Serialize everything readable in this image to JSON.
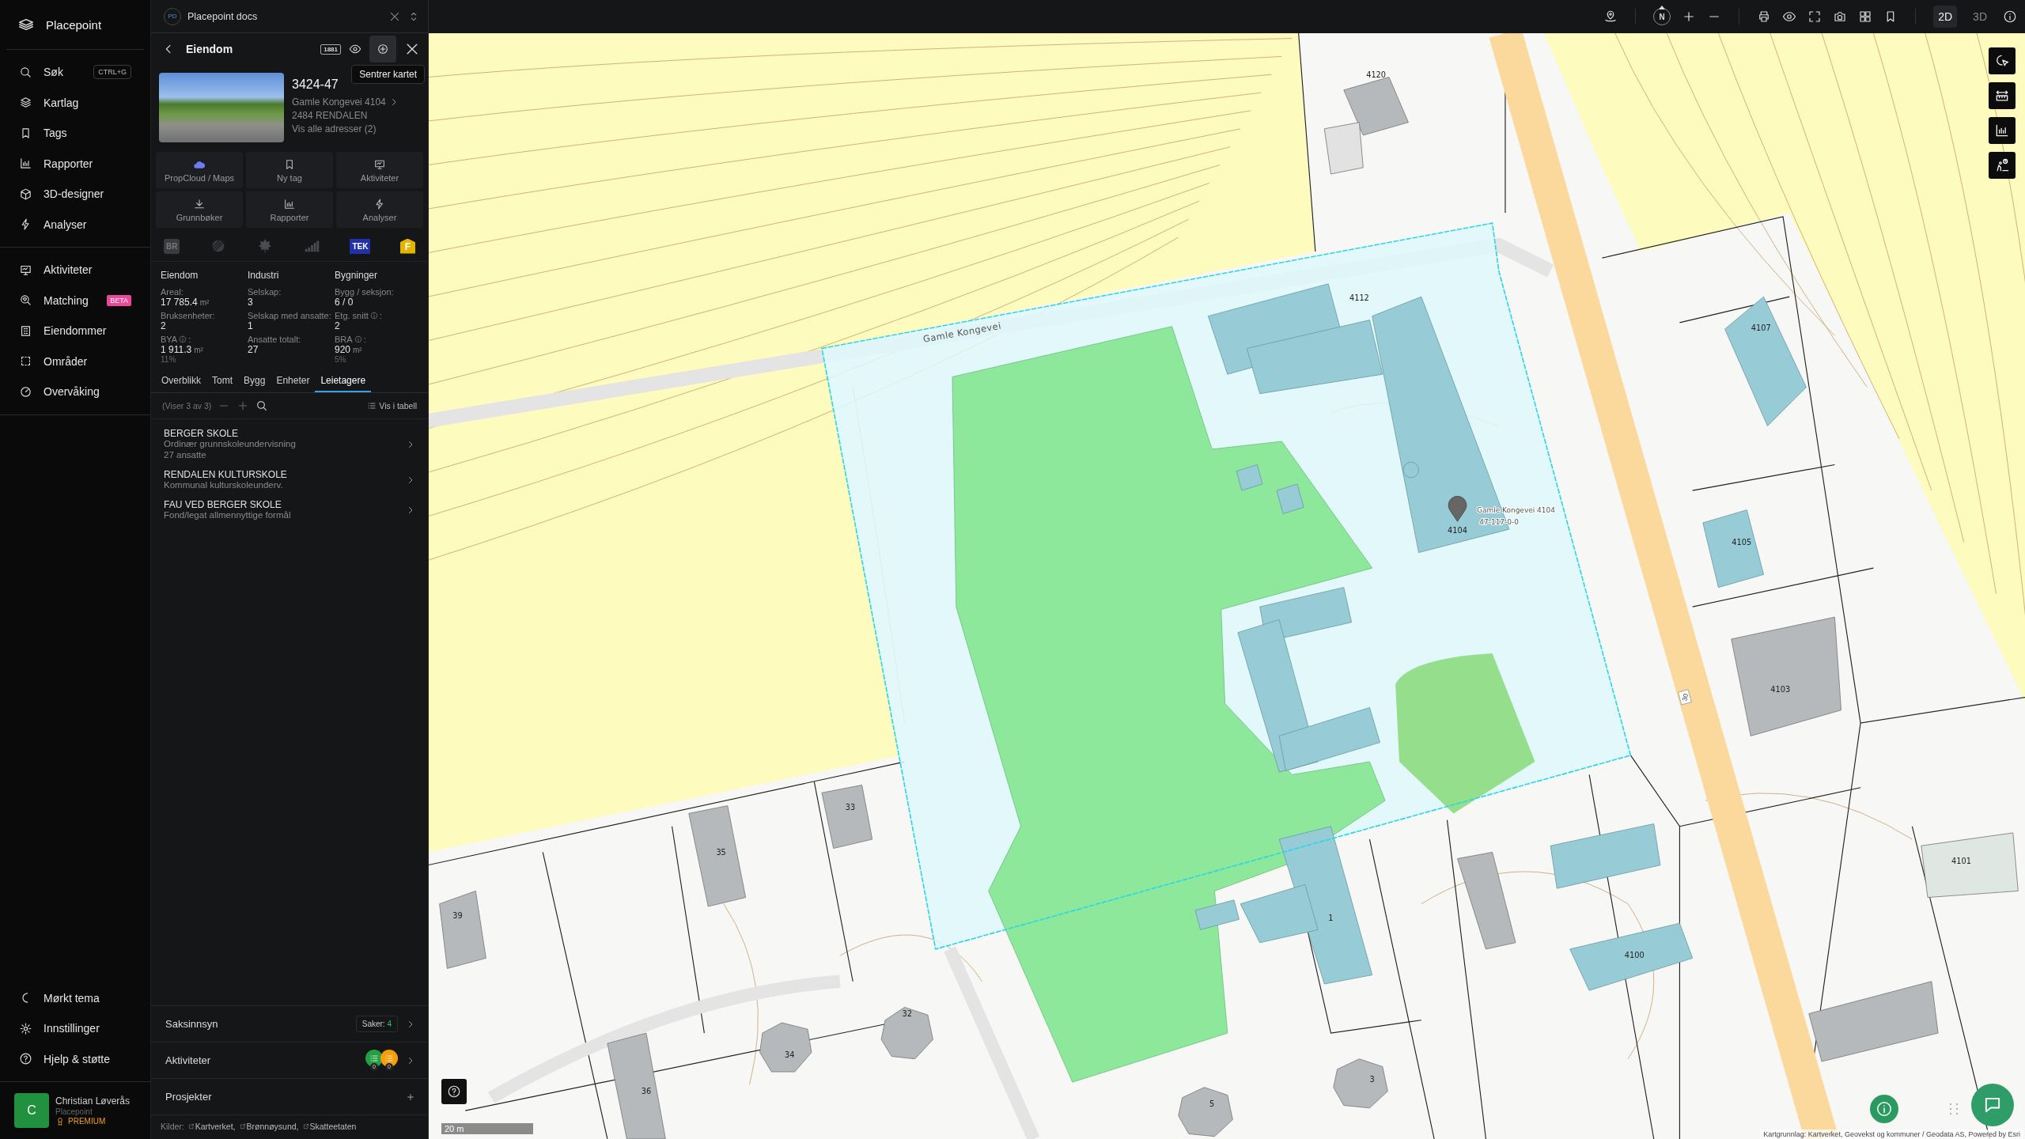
{
  "sidebar": {
    "brand": "Placepoint",
    "main_nav": [
      {
        "label": "Søk",
        "shortcut": "CTRL+G"
      },
      {
        "label": "Kartlag"
      },
      {
        "label": "Tags"
      },
      {
        "label": "Rapporter"
      },
      {
        "label": "3D-designer"
      },
      {
        "label": "Analyser"
      }
    ],
    "work_nav": [
      {
        "label": "Aktiviteter"
      },
      {
        "label": "Matching",
        "badge": "BETA"
      },
      {
        "label": "Eiendommer"
      },
      {
        "label": "Områder"
      },
      {
        "label": "Overvåking"
      }
    ],
    "footer_nav": [
      {
        "label": "Mørkt tema"
      },
      {
        "label": "Innstillinger"
      },
      {
        "label": "Hjelp & støtte"
      }
    ],
    "user": {
      "initial": "C",
      "name": "Christian Løverås",
      "org": "Placepoint",
      "plan": "PREMIUM"
    }
  },
  "panel": {
    "workspace": {
      "initials": "PD",
      "name": "Placepoint docs"
    },
    "header": {
      "title": "Eiendom",
      "phonebook_logo": "1881",
      "tooltip": "Sentrer kartet"
    },
    "property": {
      "id": "3424-47",
      "address": "Gamle Kongevei 4104",
      "postal": "2484 RENDALEN",
      "all_addresses": "Vis alle adresser (2)"
    },
    "actions": [
      "PropCloud / Maps",
      "Ny tag",
      "Aktiviteter",
      "Grunnbøker",
      "Rapporter",
      "Analyser"
    ],
    "sources": [
      {
        "kind": "br",
        "label": "BR"
      },
      {
        "kind": "hatch"
      },
      {
        "kind": "leaf"
      },
      {
        "kind": "bars"
      },
      {
        "kind": "tek",
        "label": "TEK"
      },
      {
        "kind": "fire",
        "label": "F"
      }
    ],
    "stats": [
      {
        "heading": "Eiendom",
        "fields": [
          {
            "label": "Areal:",
            "value": "17 785.4",
            "unit": "m²"
          },
          {
            "label": "Bruksenheter:",
            "value": "2"
          },
          {
            "label": "BYA",
            "info": true,
            "label_end": ":",
            "value": "1 911.3",
            "unit": "m²",
            "note": "11%"
          }
        ]
      },
      {
        "heading": "Industri",
        "fields": [
          {
            "label": "Selskap:",
            "value": "3"
          },
          {
            "label": "Selskap med ansatte:",
            "value": "1"
          },
          {
            "label": "Ansatte totalt:",
            "value": "27"
          }
        ]
      },
      {
        "heading": "Bygninger",
        "fields": [
          {
            "label": "Bygg / seksjon:",
            "value": "6 / 0"
          },
          {
            "label": "Etg. snitt",
            "info": true,
            "label_end": ":",
            "value": "2"
          },
          {
            "label": "BRA",
            "info": true,
            "label_end": ":",
            "value": "920",
            "unit": "m²",
            "note": "5%"
          }
        ]
      }
    ],
    "tabs": [
      {
        "label": "Overblikk",
        "selected": false
      },
      {
        "label": "Tomt",
        "selected": false
      },
      {
        "label": "Bygg",
        "selected": false
      },
      {
        "label": "Enheter",
        "selected": false
      },
      {
        "label": "Leietagere",
        "selected": true
      }
    ],
    "list_toolbar": {
      "count": "(Viser 3 av 3)",
      "table_link": "Vis i tabell"
    },
    "tenants": [
      {
        "name": "BERGER SKOLE",
        "lines": [
          "Ordinær grunnskoleundervisning",
          "27 ansatte"
        ]
      },
      {
        "name": "RENDALEN KULTURSKOLE",
        "lines": [
          "Kommunal kulturskoleunderv."
        ]
      },
      {
        "name": "FAU VED BERGER SKOLE",
        "lines": [
          "Fond/legat allmennyttige formål"
        ]
      }
    ],
    "sections": [
      {
        "kind": "cases",
        "title": "Saksinnsyn",
        "badge_label": "Saker:",
        "badge_value": "4"
      },
      {
        "kind": "activities",
        "title": "Aktiviteter",
        "counters": [
          {
            "color": "#23a046",
            "count": "0"
          },
          {
            "color": "#f59e0b",
            "count": "0"
          }
        ]
      },
      {
        "kind": "projects",
        "title": "Prosjekter"
      }
    ],
    "credits": {
      "label": "Kilder:",
      "links": [
        "Kartverket,",
        "Brønnøysund,",
        "Skatteetaten"
      ]
    }
  },
  "map": {
    "toolbar": {
      "compass": "N",
      "modes": [
        {
          "label": "2D",
          "selected": true
        },
        {
          "label": "3D",
          "selected": false
        }
      ]
    },
    "road_label": "Gamle Kongevei",
    "route_number": "30",
    "pin": {
      "title": "Gamle Kongevei 4104",
      "subtitle": "47-117-0-0"
    },
    "building_numbers": [
      "4120",
      "4112",
      "4107",
      "4105",
      "4104",
      "4103",
      "4101",
      "4100",
      "33",
      "35",
      "39",
      "36",
      "34",
      "32",
      "5",
      "3",
      "1"
    ],
    "scale": "20 m",
    "attribution": "Kartgrunnlag: Kartverket, Geovekst og kommuner / Geodata AS, Powered by Esri"
  }
}
